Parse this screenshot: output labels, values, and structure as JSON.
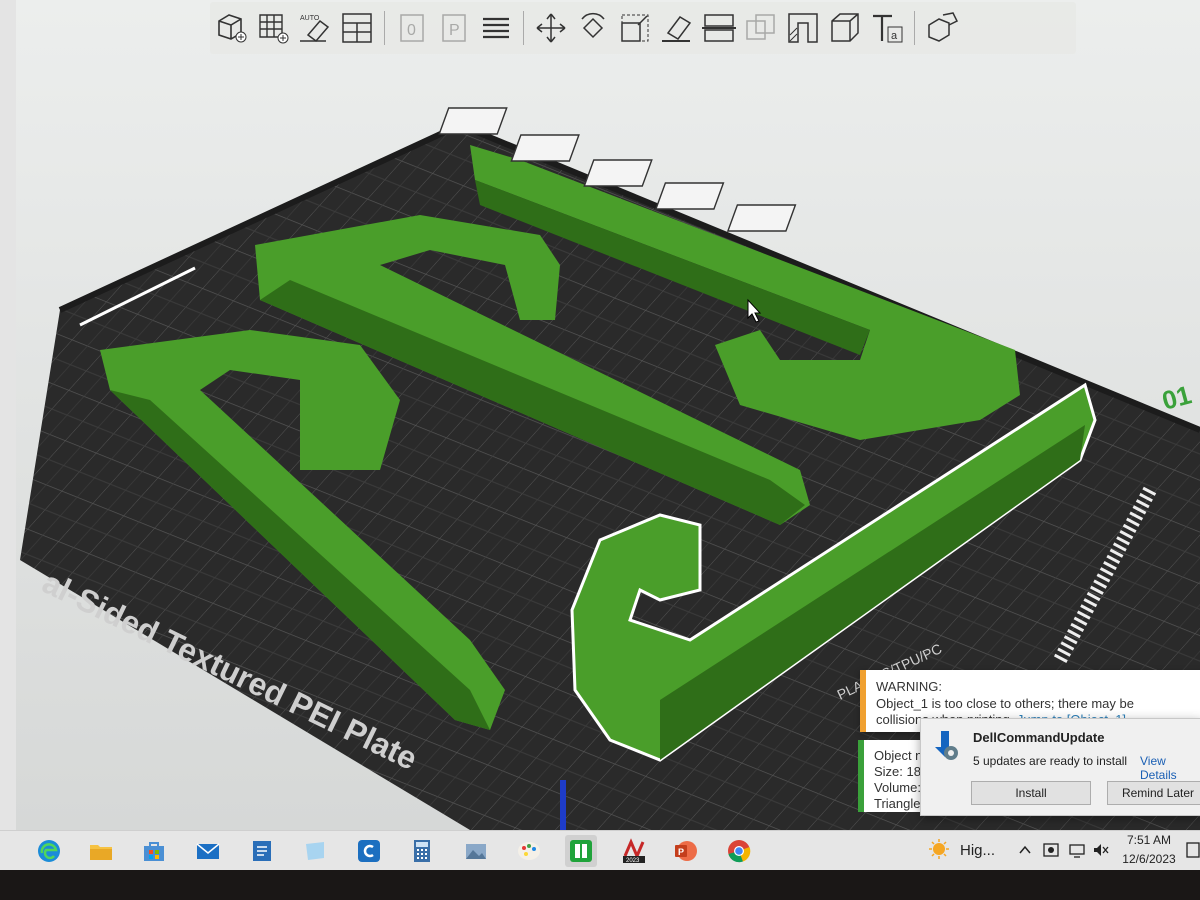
{
  "toolbar": {
    "icons": [
      "add-object-icon",
      "add-plate-icon",
      "auto-orient-icon",
      "arrange-icon",
      "copy-plate-icon",
      "paste-plate-icon",
      "layers-list-icon",
      "move-icon",
      "rotate-icon",
      "scale-icon",
      "lay-on-face-icon",
      "split-icon",
      "cut-icon",
      "boolean-icon",
      "support-paint-icon",
      "seam-paint-icon",
      "text-icon",
      "assembly-icon"
    ],
    "auto_label": "AUTO"
  },
  "plate": {
    "label": "al-Sided Textured PEI Plate",
    "filament_text": "PLA/ABS/TPU/PC",
    "plate_number": "01",
    "plate_icons": [
      "close-plate-icon",
      "plate-settings-icon",
      "arrange-plate-icon",
      "lock-plate-icon",
      "slice-plate-icon"
    ]
  },
  "colors": {
    "model": "#4a9e2a",
    "model_dark": "#2f6e18",
    "bed": "#2a2a2a",
    "accent": "#3aa13a",
    "warning": "#f0a030"
  },
  "notifications": {
    "warning": {
      "title": "WARNING:",
      "line1": "Object_1 is too close to others; there may be",
      "line2": "collisions when printing.",
      "link": "Jump to [Object_1]"
    },
    "object_info": {
      "line1": "Object n",
      "line2": "Size: 18",
      "line3": "Volume:",
      "line4": "Triangle"
    }
  },
  "dell_popup": {
    "title": "DellCommandUpdate",
    "message": "5 updates are ready to install",
    "view_details": "View Details",
    "install": "Install",
    "remind": "Remind Later"
  },
  "taskbar": {
    "apps": [
      "edge-icon",
      "file-explorer-icon",
      "store-icon",
      "mail-icon",
      "notes-icon",
      "sticky-icon",
      "citrix-icon",
      "calculator-icon",
      "photos-icon",
      "paint-icon",
      "bambu-studio-icon",
      "autocad-icon",
      "powerpoint-icon",
      "chrome-icon"
    ],
    "autocad_year": "2023",
    "weather_text": "Hig...",
    "time": "7:51 AM",
    "date": "12/6/2023"
  }
}
